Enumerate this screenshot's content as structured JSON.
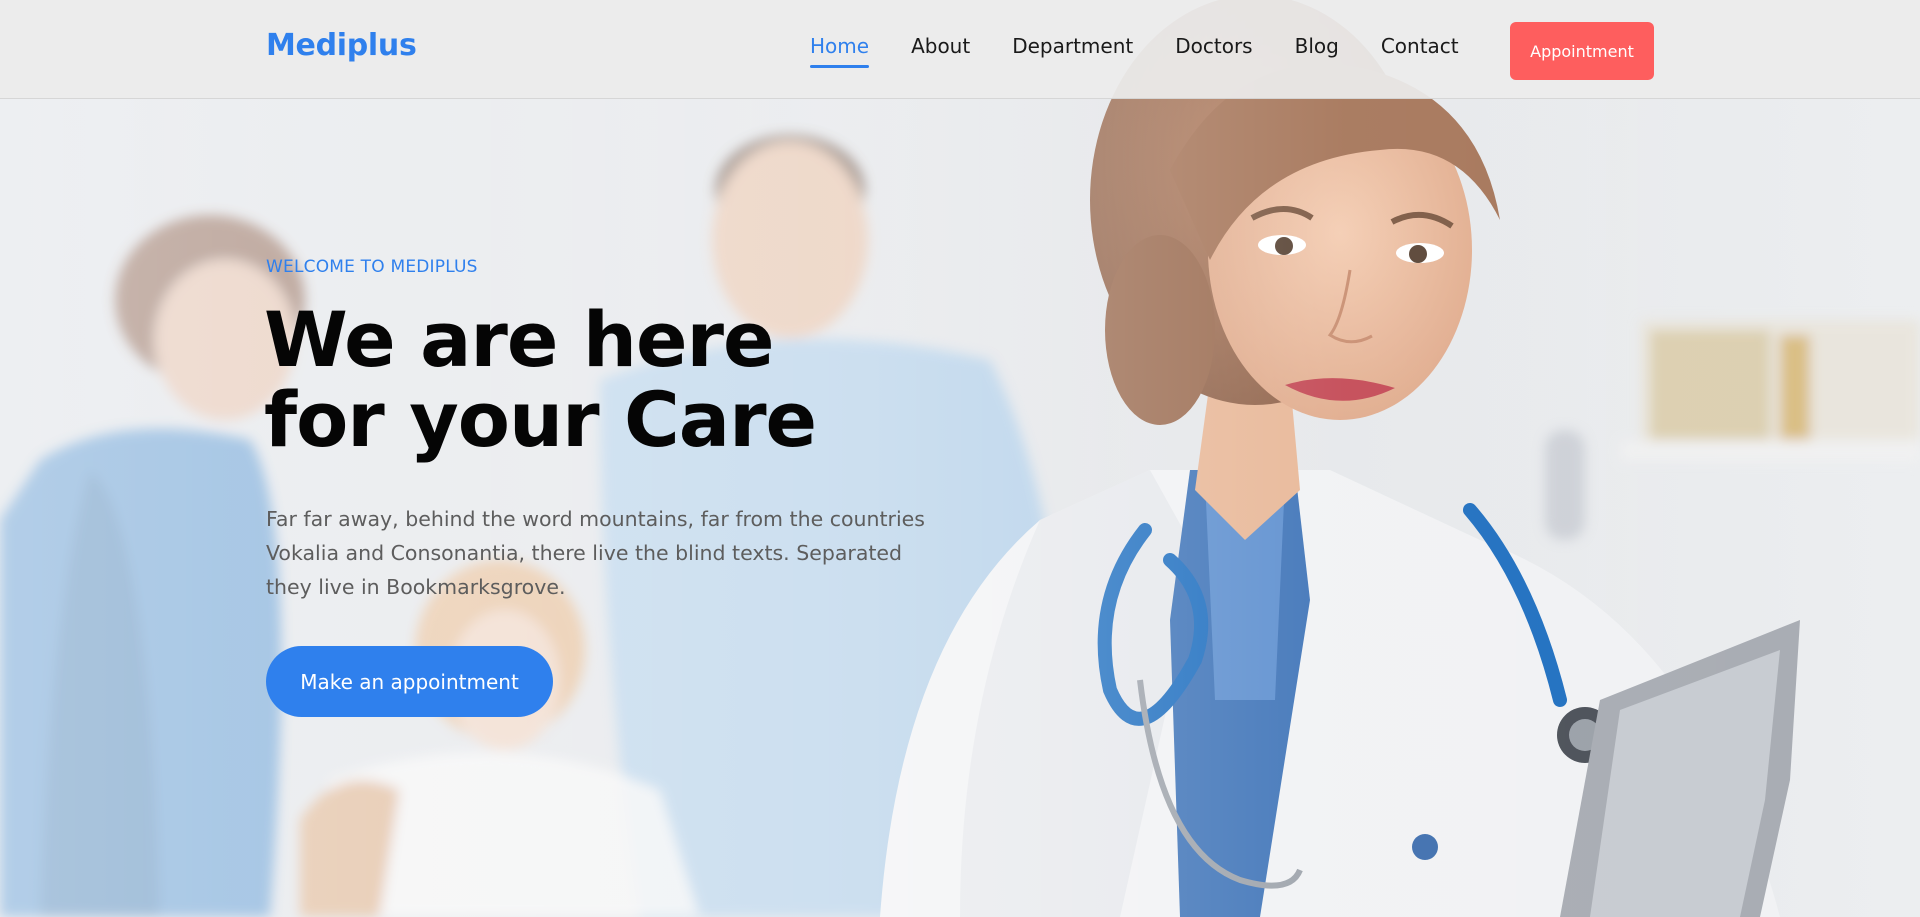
{
  "navbar": {
    "brand": "Mediplus",
    "links": [
      {
        "label": "Home",
        "active": true
      },
      {
        "label": "About",
        "active": false
      },
      {
        "label": "Department",
        "active": false
      },
      {
        "label": "Doctors",
        "active": false
      },
      {
        "label": "Blog",
        "active": false
      },
      {
        "label": "Contact",
        "active": false
      }
    ],
    "appointment_label": "Appointment"
  },
  "hero": {
    "eyebrow": "WELCOME TO MEDIPLUS",
    "headline_line1": "We are here",
    "headline_line2": "for your Care",
    "description": "Far far away, behind the word mountains, far from the countries Vokalia and Consonantia, there live the blind texts. Separated they live in Bookmarksgrove.",
    "cta_label": "Make an appointment"
  },
  "colors": {
    "brand_blue": "#2f80ed",
    "appointment_red": "#fe5e5e",
    "headline": "#050505",
    "body_text": "#5d5d5d"
  }
}
